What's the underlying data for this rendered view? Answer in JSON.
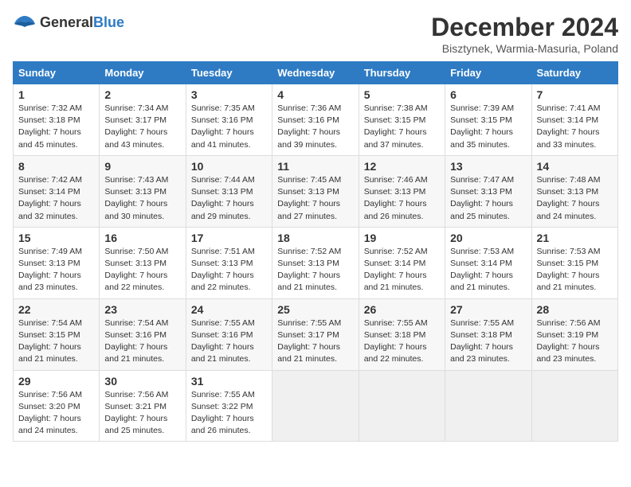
{
  "logo": {
    "general": "General",
    "blue": "Blue"
  },
  "title": "December 2024",
  "subtitle": "Bisztynek, Warmia-Masuria, Poland",
  "days_header": [
    "Sunday",
    "Monday",
    "Tuesday",
    "Wednesday",
    "Thursday",
    "Friday",
    "Saturday"
  ],
  "weeks": [
    [
      {
        "day": "1",
        "sunrise": "7:32 AM",
        "sunset": "3:18 PM",
        "daylight": "7 hours and 45 minutes."
      },
      {
        "day": "2",
        "sunrise": "7:34 AM",
        "sunset": "3:17 PM",
        "daylight": "7 hours and 43 minutes."
      },
      {
        "day": "3",
        "sunrise": "7:35 AM",
        "sunset": "3:16 PM",
        "daylight": "7 hours and 41 minutes."
      },
      {
        "day": "4",
        "sunrise": "7:36 AM",
        "sunset": "3:16 PM",
        "daylight": "7 hours and 39 minutes."
      },
      {
        "day": "5",
        "sunrise": "7:38 AM",
        "sunset": "3:15 PM",
        "daylight": "7 hours and 37 minutes."
      },
      {
        "day": "6",
        "sunrise": "7:39 AM",
        "sunset": "3:15 PM",
        "daylight": "7 hours and 35 minutes."
      },
      {
        "day": "7",
        "sunrise": "7:41 AM",
        "sunset": "3:14 PM",
        "daylight": "7 hours and 33 minutes."
      }
    ],
    [
      {
        "day": "8",
        "sunrise": "7:42 AM",
        "sunset": "3:14 PM",
        "daylight": "7 hours and 32 minutes."
      },
      {
        "day": "9",
        "sunrise": "7:43 AM",
        "sunset": "3:13 PM",
        "daylight": "7 hours and 30 minutes."
      },
      {
        "day": "10",
        "sunrise": "7:44 AM",
        "sunset": "3:13 PM",
        "daylight": "7 hours and 29 minutes."
      },
      {
        "day": "11",
        "sunrise": "7:45 AM",
        "sunset": "3:13 PM",
        "daylight": "7 hours and 27 minutes."
      },
      {
        "day": "12",
        "sunrise": "7:46 AM",
        "sunset": "3:13 PM",
        "daylight": "7 hours and 26 minutes."
      },
      {
        "day": "13",
        "sunrise": "7:47 AM",
        "sunset": "3:13 PM",
        "daylight": "7 hours and 25 minutes."
      },
      {
        "day": "14",
        "sunrise": "7:48 AM",
        "sunset": "3:13 PM",
        "daylight": "7 hours and 24 minutes."
      }
    ],
    [
      {
        "day": "15",
        "sunrise": "7:49 AM",
        "sunset": "3:13 PM",
        "daylight": "7 hours and 23 minutes."
      },
      {
        "day": "16",
        "sunrise": "7:50 AM",
        "sunset": "3:13 PM",
        "daylight": "7 hours and 22 minutes."
      },
      {
        "day": "17",
        "sunrise": "7:51 AM",
        "sunset": "3:13 PM",
        "daylight": "7 hours and 22 minutes."
      },
      {
        "day": "18",
        "sunrise": "7:52 AM",
        "sunset": "3:13 PM",
        "daylight": "7 hours and 21 minutes."
      },
      {
        "day": "19",
        "sunrise": "7:52 AM",
        "sunset": "3:14 PM",
        "daylight": "7 hours and 21 minutes."
      },
      {
        "day": "20",
        "sunrise": "7:53 AM",
        "sunset": "3:14 PM",
        "daylight": "7 hours and 21 minutes."
      },
      {
        "day": "21",
        "sunrise": "7:53 AM",
        "sunset": "3:15 PM",
        "daylight": "7 hours and 21 minutes."
      }
    ],
    [
      {
        "day": "22",
        "sunrise": "7:54 AM",
        "sunset": "3:15 PM",
        "daylight": "7 hours and 21 minutes."
      },
      {
        "day": "23",
        "sunrise": "7:54 AM",
        "sunset": "3:16 PM",
        "daylight": "7 hours and 21 minutes."
      },
      {
        "day": "24",
        "sunrise": "7:55 AM",
        "sunset": "3:16 PM",
        "daylight": "7 hours and 21 minutes."
      },
      {
        "day": "25",
        "sunrise": "7:55 AM",
        "sunset": "3:17 PM",
        "daylight": "7 hours and 21 minutes."
      },
      {
        "day": "26",
        "sunrise": "7:55 AM",
        "sunset": "3:18 PM",
        "daylight": "7 hours and 22 minutes."
      },
      {
        "day": "27",
        "sunrise": "7:55 AM",
        "sunset": "3:18 PM",
        "daylight": "7 hours and 23 minutes."
      },
      {
        "day": "28",
        "sunrise": "7:56 AM",
        "sunset": "3:19 PM",
        "daylight": "7 hours and 23 minutes."
      }
    ],
    [
      {
        "day": "29",
        "sunrise": "7:56 AM",
        "sunset": "3:20 PM",
        "daylight": "7 hours and 24 minutes."
      },
      {
        "day": "30",
        "sunrise": "7:56 AM",
        "sunset": "3:21 PM",
        "daylight": "7 hours and 25 minutes."
      },
      {
        "day": "31",
        "sunrise": "7:55 AM",
        "sunset": "3:22 PM",
        "daylight": "7 hours and 26 minutes."
      },
      null,
      null,
      null,
      null
    ]
  ]
}
